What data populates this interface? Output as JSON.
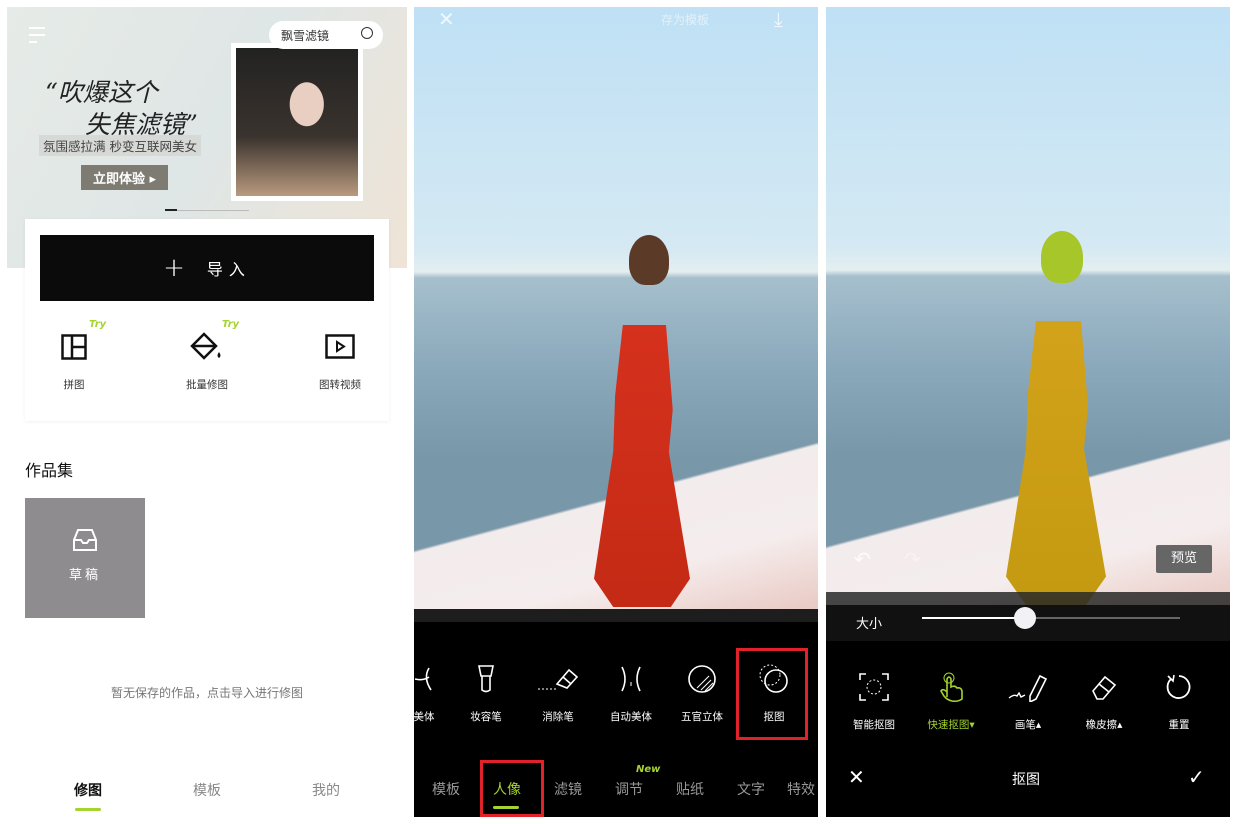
{
  "home": {
    "banner": {
      "search_text": "飘雪滤镜",
      "headline_1": "“吹爆这个",
      "headline_2": "失焦滤镜”",
      "subtitle": "氛围感拉满 秒变互联网美女",
      "cta": "立即体验 ▸"
    },
    "import_label": "导入",
    "tools": [
      {
        "label": "拼图",
        "badge": "Try",
        "icon": "collage-icon"
      },
      {
        "label": "批量修图",
        "badge": "Try",
        "icon": "paint-bucket-icon"
      },
      {
        "label": "图转视频",
        "badge": "",
        "icon": "video-icon"
      }
    ],
    "section_title": "作品集",
    "draft_label": "草稿",
    "empty_text": "暂无保存的作品，点击导入进行修图",
    "nav": [
      {
        "label": "修图",
        "active": true
      },
      {
        "label": "模板",
        "active": false
      },
      {
        "label": "我的",
        "active": false
      }
    ]
  },
  "editor": {
    "save_template": "存为模板",
    "tools": [
      {
        "label": "美体"
      },
      {
        "label": "妆容笔"
      },
      {
        "label": "消除笔"
      },
      {
        "label": "自动美体"
      },
      {
        "label": "五官立体"
      },
      {
        "label": "抠图",
        "highlighted": true
      }
    ],
    "tabs": [
      {
        "label": "模板"
      },
      {
        "label": "人像",
        "active": true
      },
      {
        "label": "滤镜"
      },
      {
        "label": "调节",
        "badge": "New"
      },
      {
        "label": "贴纸"
      },
      {
        "label": "文字"
      },
      {
        "label": "特效"
      }
    ]
  },
  "cutout": {
    "preview": "预览",
    "size_label": "大小",
    "size_value": 0.4,
    "tools": [
      {
        "label": "智能抠图"
      },
      {
        "label": "快速抠图▾",
        "active": true
      },
      {
        "label": "画笔▴"
      },
      {
        "label": "橡皮擦▴"
      },
      {
        "label": "重置"
      }
    ],
    "title": "抠图"
  },
  "colors": {
    "accent": "#a5d32f",
    "highlight": "#e0232b",
    "draft_tile": "#8e8c8e"
  }
}
